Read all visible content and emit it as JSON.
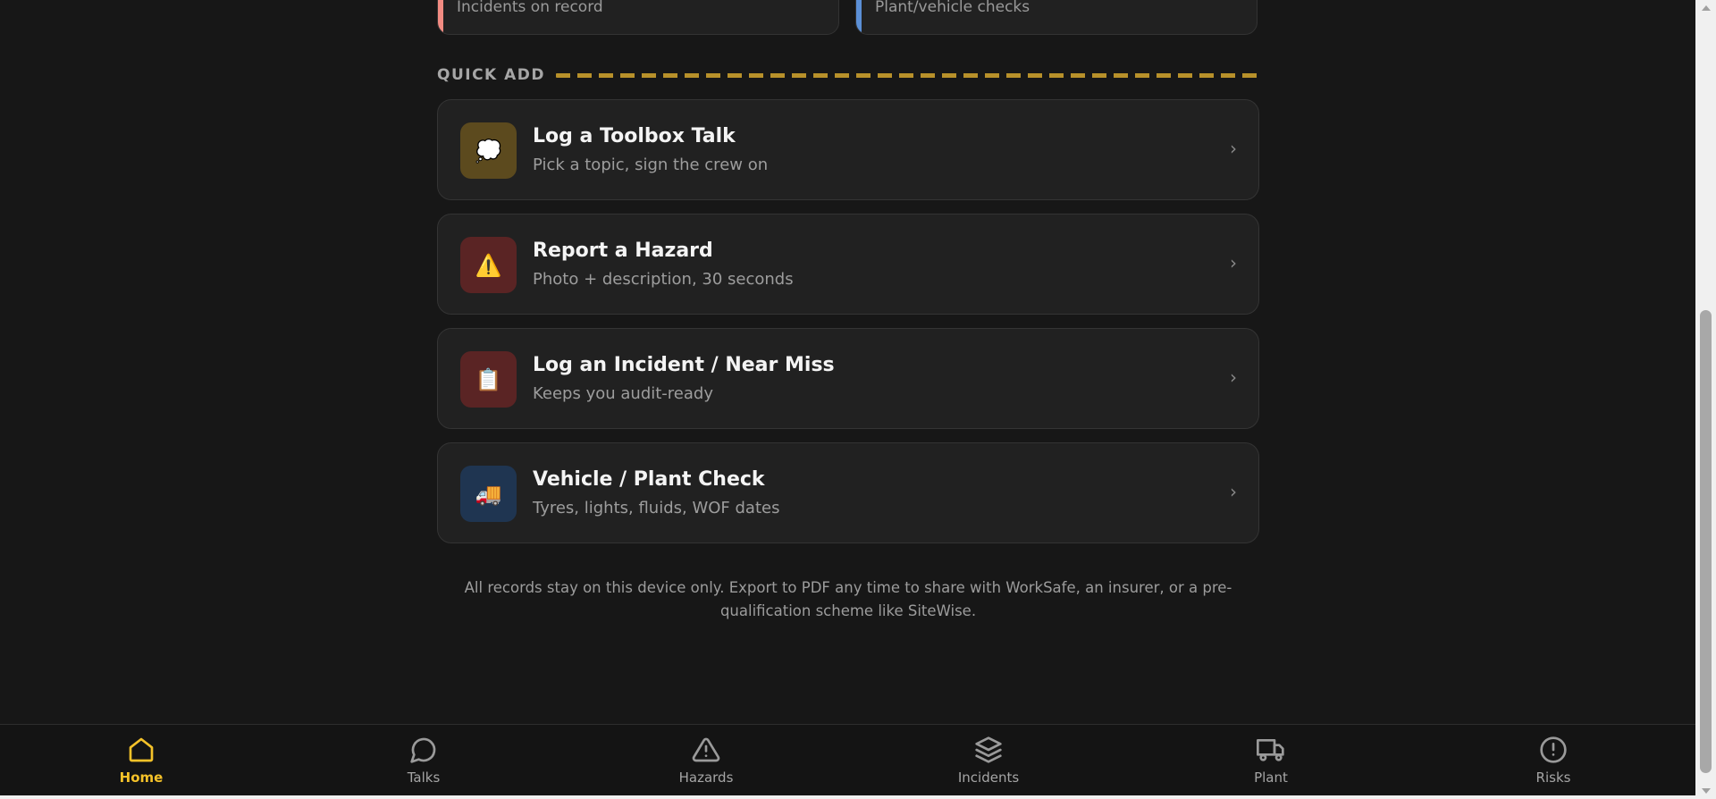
{
  "stats": {
    "incidents_label": "Incidents on record",
    "incidents_accent": "#f28b82",
    "plant_label": "Plant/vehicle checks",
    "plant_accent": "#5b8fd6"
  },
  "quick_add": {
    "title": "QUICK ADD",
    "stripe_color": "#b8912a",
    "actions": [
      {
        "title": "Log a Toolbox Talk",
        "subtitle": "Pick a topic, sign the crew on",
        "icon": "speech-bubble-icon",
        "icon_bg": "#5c4a1e",
        "glyph": "💭"
      },
      {
        "title": "Report a Hazard",
        "subtitle": "Photo + description, 30 seconds",
        "icon": "warning-icon",
        "icon_bg": "#5a2424",
        "glyph": "⚠️"
      },
      {
        "title": "Log an Incident / Near Miss",
        "subtitle": "Keeps you audit-ready",
        "icon": "clipboard-icon",
        "icon_bg": "#5a2424",
        "glyph": "📋"
      },
      {
        "title": "Vehicle / Plant Check",
        "subtitle": "Tyres, lights, fluids, WOF dates",
        "icon": "truck-icon",
        "icon_bg": "#1f3551",
        "glyph": "🚚"
      }
    ],
    "chevron": "›"
  },
  "footer_note": "All records stay on this device only. Export to PDF any time to share with WorkSafe, an insurer, or a pre-qualification scheme like SiteWise.",
  "nav": {
    "active_color": "#f5c229",
    "items": [
      {
        "label": "Home",
        "icon": "home-icon",
        "active": true
      },
      {
        "label": "Talks",
        "icon": "chat-bubble-icon",
        "active": false
      },
      {
        "label": "Hazards",
        "icon": "warning-triangle-icon",
        "active": false
      },
      {
        "label": "Incidents",
        "icon": "layers-icon",
        "active": false
      },
      {
        "label": "Plant",
        "icon": "truck-icon",
        "active": false
      },
      {
        "label": "Risks",
        "icon": "alert-circle-icon",
        "active": false
      }
    ]
  }
}
